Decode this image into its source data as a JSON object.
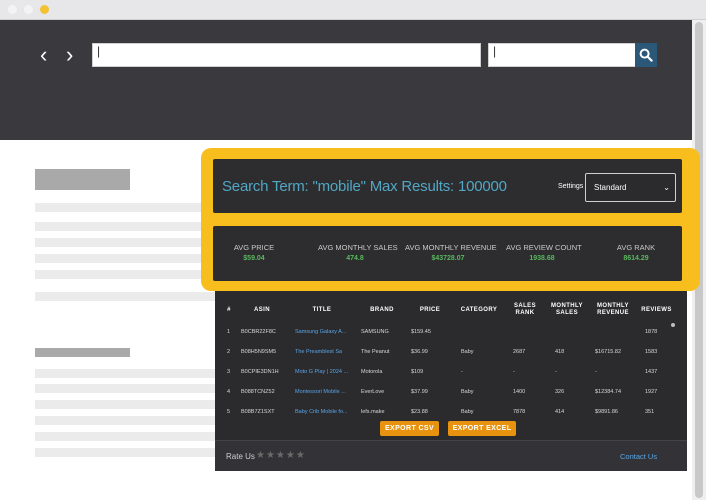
{
  "browser": {
    "back_glyph": "‹",
    "forward_glyph": "›",
    "url_value": "|",
    "search_value": "|"
  },
  "panel": {
    "search_term_text": "Search Term: \"mobile\" Max Results: 100000",
    "settings_label": "Settings",
    "settings_selected": "Standard",
    "stats": [
      {
        "label": "AVG PRICE",
        "value": "$59.04"
      },
      {
        "label": "AVG MONTHLY SALES",
        "value": "474.8"
      },
      {
        "label": "AVG MONTHLY REVENUE",
        "value": "$43728.07"
      },
      {
        "label": "AVG REVIEW COUNT",
        "value": "1938.68"
      },
      {
        "label": "AVG RANK",
        "value": "8614.29"
      }
    ],
    "table": {
      "headers": [
        "#",
        "ASIN",
        "TITLE",
        "BRAND",
        "PRICE",
        "CATEGORY",
        "SALES RANK",
        "MONTHLY SALES",
        "MONTHLY REVENUE",
        "REVIEWS"
      ],
      "rows": [
        [
          "1",
          "B0CBR22F8C",
          "Samsung Galaxy A...",
          "SAMSUNG",
          "$159.45",
          "",
          "",
          "",
          "",
          "1878"
        ],
        [
          "2",
          "B08H5N9SM5",
          "The Preamblest Sa",
          "The Peanut",
          "$36.99",
          "Baby",
          "2687",
          "418",
          "$16715.82",
          "1583"
        ],
        [
          "3",
          "B0CPIE3DN1H",
          "Moto G Play | 2024 ...",
          "Motorola",
          "$109",
          "-",
          "-",
          "-",
          "-",
          "1437"
        ],
        [
          "4",
          "B088TCNZ52",
          "Montessori Mobile ...",
          "EverLove",
          "$37.99",
          "Baby",
          "1400",
          "326",
          "$12384.74",
          "1927"
        ],
        [
          "5",
          "B08B7Z1SXT",
          "Baby Crib Mobile fo...",
          "lefs.make",
          "$23.88",
          "Baby",
          "7878",
          "414",
          "$9891.86",
          "351"
        ]
      ]
    },
    "export_csv_label": "EXPORT CSV",
    "export_excel_label": "EXPORT EXCEL",
    "rate_label": "Rate Us",
    "stars": "★★★★★",
    "contact_label": "Contact Us"
  }
}
